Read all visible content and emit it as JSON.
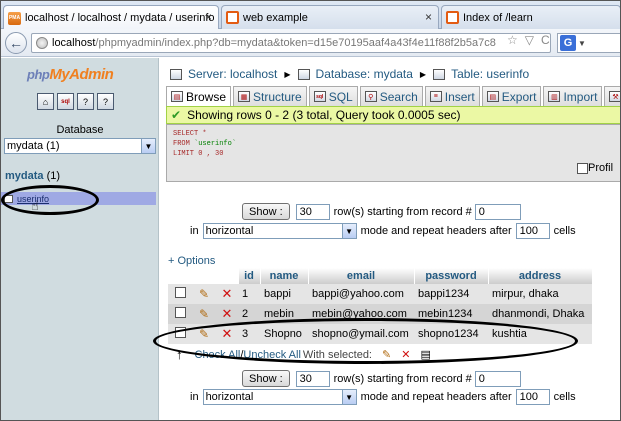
{
  "browser": {
    "tabs": [
      {
        "label": "localhost / localhost / mydata / userinfo | p",
        "icon": "phpmyadmin-favicon-icon",
        "active": true
      },
      {
        "label": "web example",
        "icon": "xampp-favicon-icon",
        "active": false
      },
      {
        "label": "Index of /learn",
        "icon": "xampp-favicon-icon",
        "active": false
      }
    ],
    "tab_close": "×",
    "fav_pma": "PMA",
    "fav_other": "⊠",
    "back": "←",
    "url_host": "localhost",
    "url_path": "/phpmyadmin/index.php?db=mydata&token=d15e70195aaf4a43f4e11f88f2b5a7c8",
    "url_icons": [
      "☆",
      "▽",
      "C"
    ],
    "search_engine": "G",
    "search_arrow": "▼"
  },
  "left": {
    "logo_php": "php",
    "logo_myadmin": "MyAdmin",
    "nav_icons": [
      "home-icon",
      "sql-icon",
      "docs-icon",
      "settings-icon"
    ],
    "nav_icon_glyphs": [
      "⌂",
      "sql",
      "?",
      "?"
    ],
    "database_label": "Database",
    "db_select_value": "mydata (1)",
    "select_arrow": "▼",
    "db_title_name": "mydata",
    "db_title_count": "(1)",
    "table_name": "userinfo",
    "cursor": "☝"
  },
  "header": {
    "server_label": "Server: localhost",
    "database_label": "Database: mydata",
    "table_label": "Table: userinfo",
    "separator": "▶"
  },
  "tabs": [
    {
      "label": "Browse",
      "icon": "browse-icon",
      "glyph": "▤",
      "active": true
    },
    {
      "label": "Structure",
      "icon": "structure-icon",
      "glyph": "▦",
      "active": false
    },
    {
      "label": "SQL",
      "icon": "sql-icon",
      "glyph": "sql",
      "active": false
    },
    {
      "label": "Search",
      "icon": "search-icon",
      "glyph": "⚲",
      "active": false
    },
    {
      "label": "Insert",
      "icon": "insert-icon",
      "glyph": "≡",
      "active": false
    },
    {
      "label": "Export",
      "icon": "export-icon",
      "glyph": "▤",
      "active": false
    },
    {
      "label": "Import",
      "icon": "import-icon",
      "glyph": "▥",
      "active": false
    },
    {
      "label": "O",
      "icon": "operations-icon",
      "glyph": "⚒",
      "active": false
    }
  ],
  "message": {
    "check": "✔",
    "text": "Showing rows 0 - 2 (3 total, Query took 0.0005 sec)"
  },
  "sql": {
    "line1": "SELECT *",
    "line2_kw": "FROM",
    "line2_str": "`userinfo`",
    "line3": "LIMIT 0 , 30"
  },
  "profiling_label": "Profil",
  "nav_controls": {
    "show_button": "Show :",
    "rows_value": "30",
    "rows_text": "row(s) starting from record #",
    "record_value": "0",
    "in_label": "in",
    "mode_value": "horizontal",
    "mode_text": "mode and repeat headers after",
    "headers_value": "100",
    "cells_text": "cells"
  },
  "options_label": "+ Options",
  "table": {
    "columns": [
      "id",
      "name",
      "email",
      "password",
      "address"
    ],
    "edit_glyph": "✎",
    "delete_glyph": "✕",
    "rows": [
      {
        "id": "1",
        "name": "bappi",
        "email": "bappi@yahoo.com",
        "password": "bappi1234",
        "address": "mirpur, dhaka"
      },
      {
        "id": "2",
        "name": "mebin",
        "email": "mebin@yahoo.com",
        "password": "mebin1234",
        "address": "dhanmondi, Dhaka"
      },
      {
        "id": "3",
        "name": "Shopno",
        "email": "shopno@ymail.com",
        "password": "shopno1234",
        "address": "kushtia"
      }
    ]
  },
  "bulk": {
    "arrow": "↑",
    "check_all": "Check All",
    "divider": " / ",
    "uncheck_all": "Uncheck All",
    "with_selected": "With selected:",
    "edit_glyph": "✎",
    "delete_glyph": "✕",
    "export_glyph": "▤"
  }
}
